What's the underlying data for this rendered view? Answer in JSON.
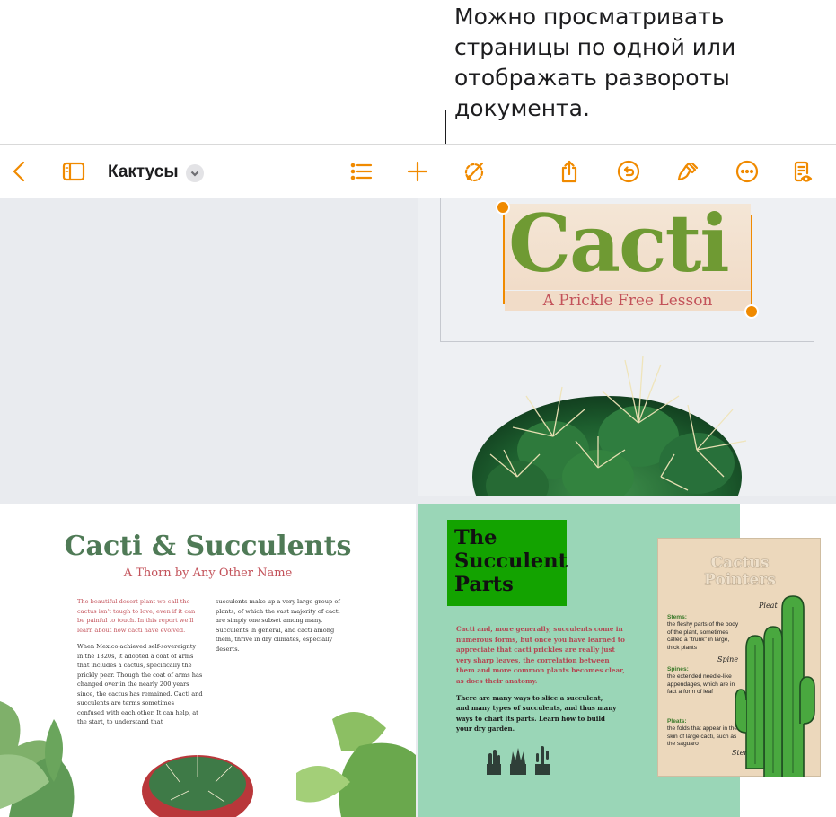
{
  "callout": {
    "lines": [
      "Можно просматривать",
      "страницы по одной или",
      "отображать развороты",
      "документа."
    ]
  },
  "toolbar": {
    "title": "Кактусы",
    "icons": [
      "back-chevron-icon",
      "sidebar-icon",
      "title-menu-chevron-icon",
      "list-icon",
      "plus-icon",
      "shapes-brush-icon",
      "share-icon",
      "undo-icon",
      "format-brush-icon",
      "more-icon",
      "reading-view-icon"
    ],
    "accent_color": "#f08a00"
  },
  "cover_page": {
    "title": "Cacti",
    "subtitle": "A Prickle Free Lesson"
  },
  "page_left": {
    "title": "Cacti & Succulents",
    "subtitle": "A Thorn by Any Other Name",
    "col1_intro": "The beautiful desert plant we call the cactus isn't tough to love, even if it can be painful to touch. In this report we'll learn about how cacti have evolved.",
    "col1_body": "When Mexico achieved self-sovereignty in the 1820s, it adopted a coat of arms that includes a cactus, specifically the prickly pear. Though the coat of arms has changed over in the nearly 200 years since, the cactus has remained. Cacti and succulents are terms sometimes confused with each other. It can help, at the start, to understand that",
    "col2_body": "succulents make up a very large group of plants, of which the vast majority of cacti are simply one subset among many. Succulents in general, and cacti among them, thrive in dry climates, especially deserts."
  },
  "page_right": {
    "title_line1": "The",
    "title_line2": "Succulent",
    "title_line3": "Parts",
    "intro": "Cacti and, more generally, succulents come in numerous forms, but once you have learned to appreciate that cacti prickles are really just very sharp leaves, the correlation between them and more common plants becomes clear, as does their anatomy.",
    "body": "There are many ways to slice a succulent, and many types of succulents, and thus many ways to chart its parts. Learn how to build your dry garden.",
    "pointers": {
      "title_line1": "Cactus",
      "title_line2": "Pointers",
      "stems_label": "Stems:",
      "stems_text": "the fleshy parts of the body of the plant, sometimes called a \"trunk\" in large, thick plants",
      "spines_label": "Spines:",
      "spines_text": "the extended needle-like appendages, which are in fact a form of leaf",
      "pleats_label": "Pleats:",
      "pleats_text": "the folds that appear in the skin of large cacti, such as the saguaro",
      "tag_pleat": "Pleat",
      "tag_spine": "Spine",
      "tag_stem": "Stem"
    }
  }
}
